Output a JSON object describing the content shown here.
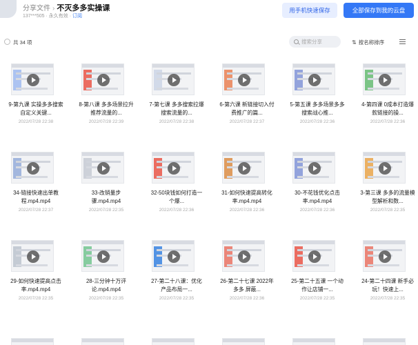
{
  "header": {
    "breadcrumb_parent": "分享文件",
    "breadcrumb_current": "不灭多多实操课",
    "user": "137***505",
    "validity": "永久有效",
    "subscribe": "订阅",
    "phone_save_label": "用手机快速保存",
    "save_all_label": "全部保存到我的云盘"
  },
  "toolbar": {
    "count": "共 34 项",
    "search_placeholder": "搜索分享",
    "sort_label": "按名称排序"
  },
  "colors": {
    "primary": "#3478f6",
    "primary_light": "#e7eeff"
  },
  "files": [
    {
      "title": "9-第九课 实操多多搜索自定义关键...",
      "date": "2022/07/28 22:38",
      "accent": "#9ab6f0"
    },
    {
      "title": "8-第八课 多多场景拉升推荐流量的...",
      "date": "2022/07/28 22:39",
      "accent": "#e84b3c"
    },
    {
      "title": "7-第七课 多多搜索拉爆搜索流量的...",
      "date": "2022/07/28 22:38",
      "accent": "#c9d3e6"
    },
    {
      "title": "6-第六课 新链接切入付费推广的篇...",
      "date": "2022/07/28 22:37",
      "accent": "#e8794a"
    },
    {
      "title": "5-第五课 多多场景多多搜索战心推...",
      "date": "2022/07/28 22:36",
      "accent": "#7a8fd6"
    },
    {
      "title": "4-第四课 0成本打造爆款链接的操...",
      "date": "2022/07/28 22:36",
      "accent": "#5db86a"
    },
    {
      "title": "34-链接快速出单教程.mp4.mp4",
      "date": "2022/07/28 22:37",
      "accent": "#8fa8d8"
    },
    {
      "title": "33-改销量步骤.mp4.mp4",
      "date": "2022/07/28 22:35",
      "accent": "#c3c8d2"
    },
    {
      "title": "32-50块钱如何打造一个爆...",
      "date": "2022/07/28 22:36",
      "accent": "#e84b3c"
    },
    {
      "title": "31-如何快速提高转化率.mp4.mp4",
      "date": "2022/07/28 22:36",
      "accent": "#d9863a"
    },
    {
      "title": "30-不花钱优化点击率.mp4.mp4",
      "date": "2022/07/28 22:36",
      "accent": "#7a8fd6"
    },
    {
      "title": "3-第三课 多多的流量模型解析和数...",
      "date": "2022/07/28 22:35",
      "accent": "#e8a040"
    },
    {
      "title": "29-如何快速提高点击率.mp4.mp4",
      "date": "2022/07/28 22:35",
      "accent": "#b8c0cc"
    },
    {
      "title": "28-三分钟十万评论.mp4.mp4",
      "date": "2022/07/28 22:35",
      "accent": "#6ac28a"
    },
    {
      "title": "27-第二十八课：优化产品布局一...",
      "date": "2022/07/28 22:35",
      "accent": "#2a7be0"
    },
    {
      "title": "26-第二十七课 2022年多多 屏蔽...",
      "date": "2022/07/28 22:36",
      "accent": "#e86a5a"
    },
    {
      "title": "25-第二十五课 一个动作让店铺一...",
      "date": "2022/07/28 22:35",
      "accent": "#e84b3c"
    },
    {
      "title": "24-第二十四课 新手必玩！快速上...",
      "date": "2022/07/28 22:35",
      "accent": "#e86a5a"
    }
  ]
}
